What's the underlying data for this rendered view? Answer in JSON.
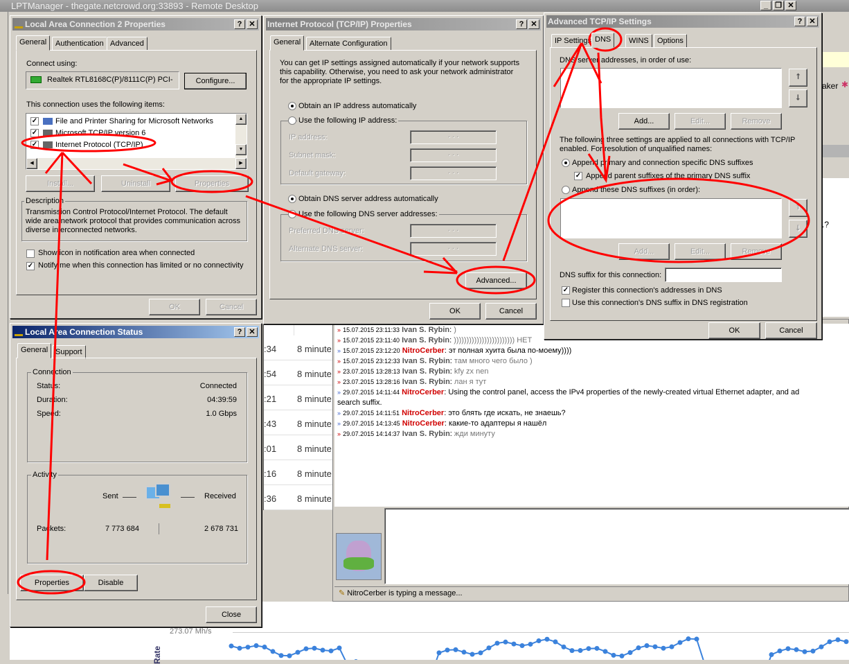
{
  "remote_desktop": {
    "title": "LPTManager - thegate.netcrowd.org:33893 - Remote Desktop"
  },
  "background": {
    "right_panel_text": "aker",
    "right_panel_question": ".?",
    "table_rows": [
      {
        "time": ":34",
        "ago": "8 minute"
      },
      {
        "time": ":54",
        "ago": "8 minute"
      },
      {
        "time": ":21",
        "ago": "8 minute"
      },
      {
        "time": ":43",
        "ago": "8 minute"
      },
      {
        "time": ":01",
        "ago": "8 minute"
      },
      {
        "time": ":16",
        "ago": "8 minute"
      },
      {
        "time": ":36",
        "ago": "8 minute"
      }
    ],
    "table_partial": "8 minute",
    "chat": [
      {
        "ts": "15.07.2015 23:11:33",
        "author": "Ivan S. Rybin",
        "text": ")",
        "dir": "in"
      },
      {
        "ts": "15.07.2015 23:11:40",
        "author": "Ivan S. Rybin",
        "text": ")))))))))))))))))))))))) НЕТ",
        "dir": "in"
      },
      {
        "ts": "15.07.2015 23:12:20",
        "author": "NitroCerber",
        "text": "эт полная хуита была по-моему))))",
        "dir": "out"
      },
      {
        "ts": "15.07.2015 23:12:33",
        "author": "Ivan S. Rybin",
        "text": "там много чего было )",
        "dir": "in"
      },
      {
        "ts": "23.07.2015 13:28:13",
        "author": "Ivan S. Rybin",
        "text": "kfy zx nen",
        "dir": "in"
      },
      {
        "ts": "23.07.2015 13:28:16",
        "author": "Ivan S. Rybin",
        "text": "лан я тут",
        "dir": "in"
      },
      {
        "ts": "29.07.2015 14:11:44",
        "author": "NitroCerber",
        "text": "Using the control panel, access the IPv4 properties of the newly-created virtual Ethernet adapter, and ad",
        "dir": "out",
        "cont": "search suffix."
      },
      {
        "ts": "29.07.2015 14:11:51",
        "author": "NitroCerber",
        "text": "это блять где искать, не знаешь?",
        "dir": "out"
      },
      {
        "ts": "29.07.2015 14:13:45",
        "author": "NitroCerber",
        "text": "какие-то адаптеры я нашёл",
        "dir": "out"
      },
      {
        "ts": "29.07.2015 14:14:37",
        "author": "Ivan S. Rybin",
        "text": "жди минуту",
        "dir": "in"
      }
    ],
    "typing_status": "NitroCerber is typing a message...",
    "chart_label": "273.07 Mh/s",
    "chart_axis_label": "Rate",
    "accent_line_color": "#3b82dc"
  },
  "lac_props": {
    "title": "Local Area Connection 2 Properties",
    "help": "?",
    "close": "✕",
    "tabs": [
      "General",
      "Authentication",
      "Advanced"
    ],
    "connect_using": "Connect using:",
    "adapter": "Realtek RTL8168C(P)/8111C(P) PCI-",
    "configure": "Configure...",
    "items_label": "This connection uses the following items:",
    "items": [
      {
        "label": "File and Printer Sharing for Microsoft Networks",
        "checked": true
      },
      {
        "label": "Microsoft TCP/IP version 6",
        "checked": true
      },
      {
        "label": "Internet Protocol (TCP/IP)",
        "checked": true
      }
    ],
    "install": "Install...",
    "uninstall": "Uninstall",
    "properties": "Properties",
    "description_label": "Description",
    "description": "Transmission Control Protocol/Internet Protocol. The default wide area network protocol that provides communication across diverse interconnected networks.",
    "show_icon": "Show icon in notification area when connected",
    "show_icon_checked": false,
    "notify": "Notify me when this connection has limited or no connectivity",
    "notify_checked": true,
    "ok": "OK",
    "cancel": "Cancel"
  },
  "tcpip": {
    "title": "Internet Protocol (TCP/IP) Properties",
    "help": "?",
    "close": "✕",
    "tabs": [
      "General",
      "Alternate Configuration"
    ],
    "intro": "You can get IP settings assigned automatically if your network supports this capability. Otherwise, you need to ask your network administrator for the appropriate IP settings.",
    "obtain_ip": "Obtain an IP address automatically",
    "use_ip": "Use the following IP address:",
    "ip_address": "IP address:",
    "subnet": "Subnet mask:",
    "gateway": "Default gateway:",
    "ip_placeholder": ".       .       .",
    "obtain_dns": "Obtain DNS server address automatically",
    "use_dns": "Use the following DNS server addresses:",
    "preferred_dns": "Preferred DNS server:",
    "alternate_dns": "Alternate DNS server:",
    "advanced": "Advanced...",
    "ok": "OK",
    "cancel": "Cancel"
  },
  "advanced": {
    "title": "Advanced TCP/IP Settings",
    "help": "?",
    "close": "✕",
    "tabs": [
      "IP Settings",
      "DNS",
      "WINS",
      "Options"
    ],
    "dns_servers_label": "DNS server addresses, in order of use:",
    "add": "Add...",
    "edit": "Edit...",
    "remove": "Remove",
    "up": "⭡",
    "down": "⭣",
    "info": "The following three settings are applied to all connections with TCP/IP enabled. For resolution of unqualified names:",
    "append_primary": "Append primary and connection specific DNS suffixes",
    "append_parent": "Append parent suffixes of the primary DNS suffix",
    "append_these": "Append these DNS suffixes (in order):",
    "suffix_label": "DNS suffix for this connection:",
    "suffix_value": "",
    "register": "Register this connection's addresses in DNS",
    "register_checked": true,
    "use_suffix": "Use this connection's DNS suffix in DNS registration",
    "use_suffix_checked": false,
    "ok": "OK",
    "cancel": "Cancel"
  },
  "status": {
    "title": "Local Area Connection Status",
    "help": "?",
    "close": "✕",
    "tabs": [
      "General",
      "Support"
    ],
    "connection_label": "Connection",
    "status_label": "Status:",
    "status_value": "Connected",
    "duration_label": "Duration:",
    "duration_value": "04:39:59",
    "speed_label": "Speed:",
    "speed_value": "1.0 Gbps",
    "activity_label": "Activity",
    "sent": "Sent",
    "received": "Received",
    "packets_label": "Packets:",
    "packets_sent": "7 773 684",
    "packets_received": "2 678 731",
    "properties": "Properties",
    "disable": "Disable",
    "close_btn": "Close"
  },
  "annotation_color": "#ff0000"
}
